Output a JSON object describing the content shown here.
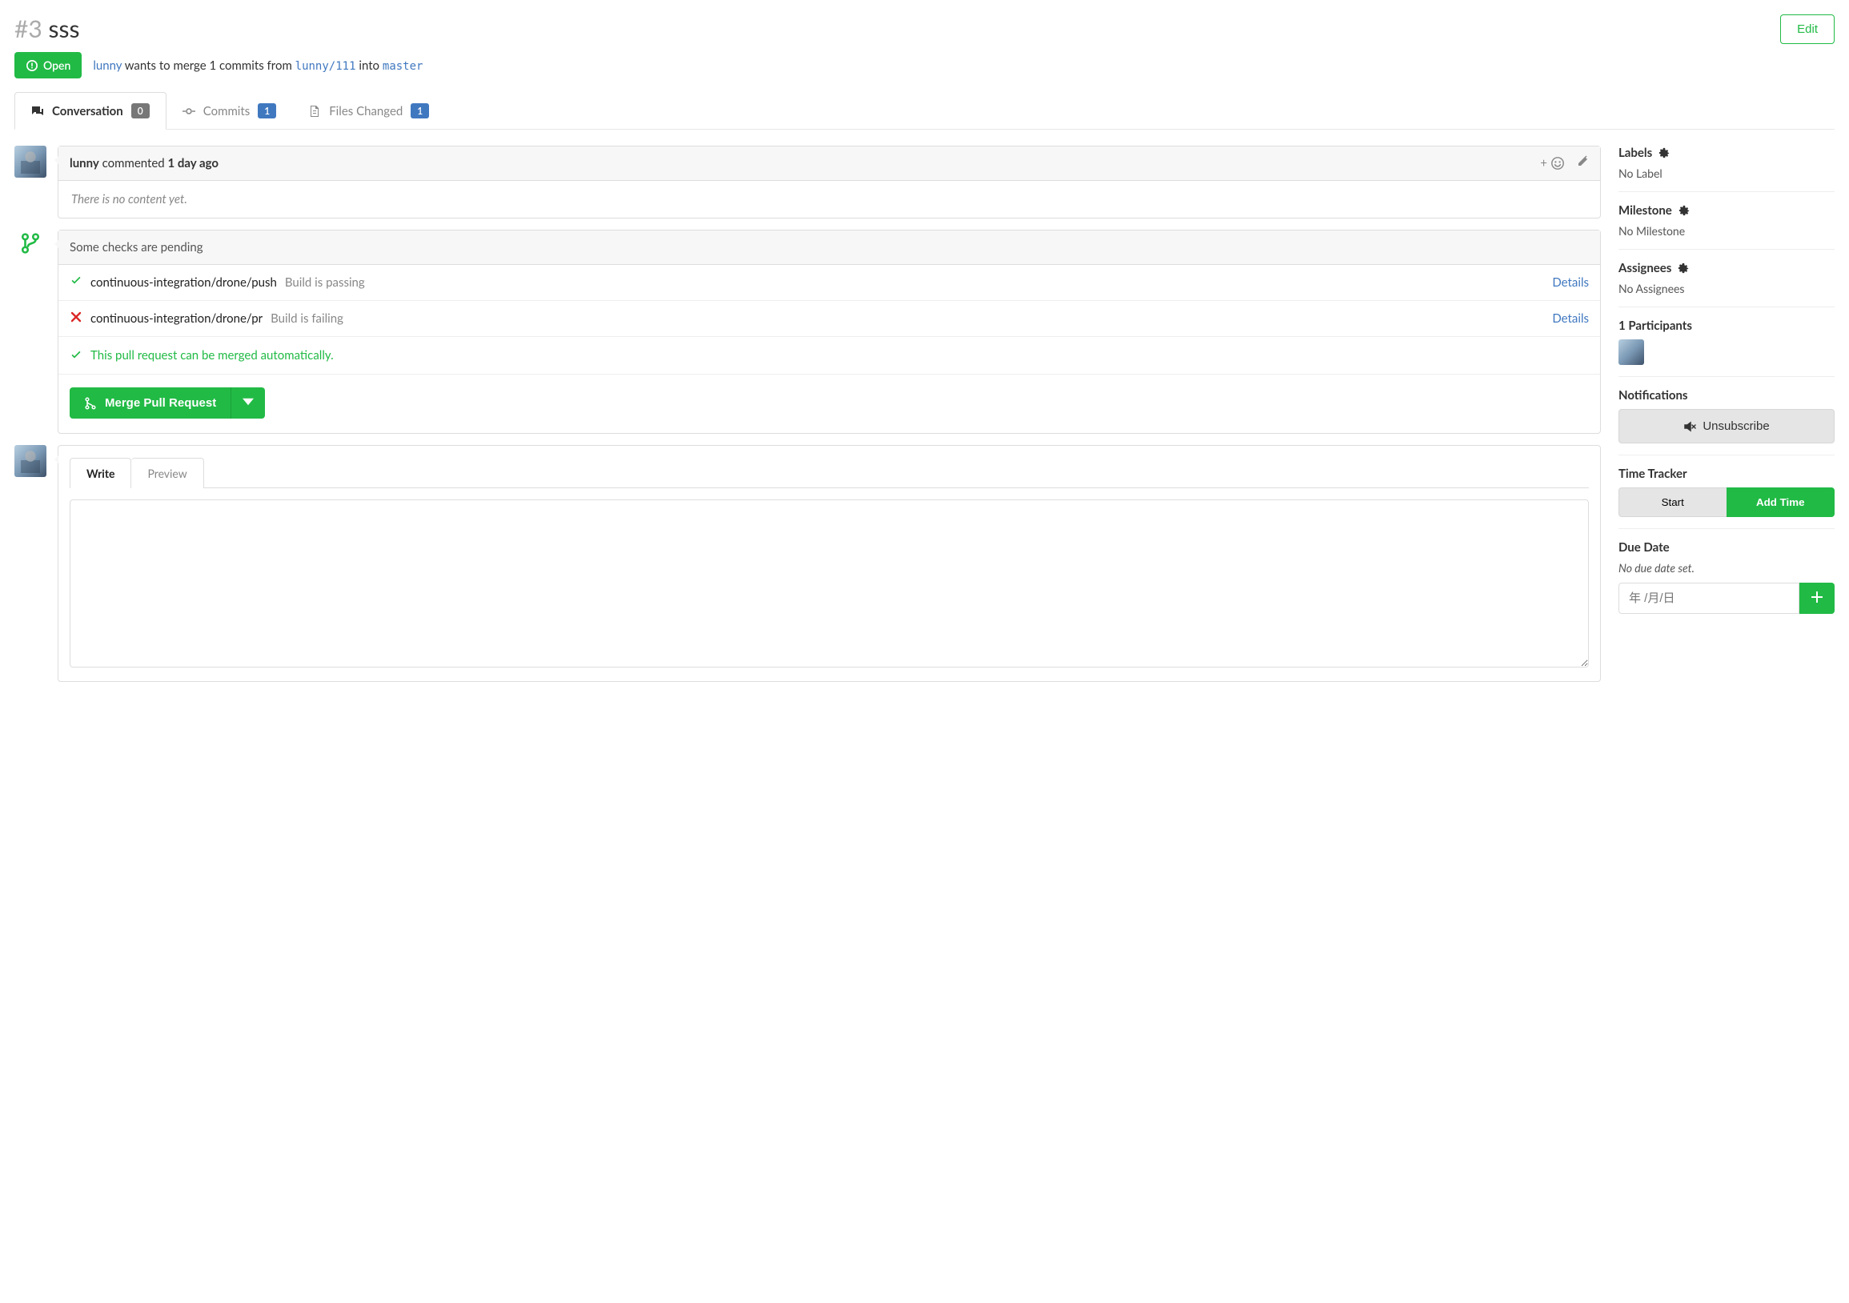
{
  "pr": {
    "number": "#3",
    "title": "sss",
    "state_label": "Open",
    "author": "lunny",
    "merge_intro": " wants to merge 1 commits from ",
    "from_branch": "lunny/111",
    "into_word": " into ",
    "to_branch": "master"
  },
  "header": {
    "edit_label": "Edit"
  },
  "tabs": {
    "conversation_label": "Conversation",
    "conversation_count": "0",
    "commits_label": "Commits",
    "commits_count": "1",
    "files_label": "Files Changed",
    "files_count": "1"
  },
  "comment": {
    "author": "lunny",
    "verb": " commented ",
    "when": "1 day ago",
    "body": "There is no content yet.",
    "react_plus": "+"
  },
  "checks": {
    "heading": "Some checks are pending",
    "rows": [
      {
        "status": "pass",
        "context": "continuous-integration/drone/push",
        "sub": "Build is passing",
        "details_label": "Details"
      },
      {
        "status": "fail",
        "context": "continuous-integration/drone/pr",
        "sub": "Build is failing",
        "details_label": "Details"
      }
    ],
    "merge_ok": "This pull request can be merged automatically.",
    "merge_button": "Merge Pull Request"
  },
  "editor": {
    "write_label": "Write",
    "preview_label": "Preview"
  },
  "sidebar": {
    "labels_head": "Labels",
    "labels_none": "No Label",
    "milestone_head": "Milestone",
    "milestone_none": "No Milestone",
    "assignees_head": "Assignees",
    "assignees_none": "No Assignees",
    "participants_head": "1 Participants",
    "notifications_head": "Notifications",
    "unsubscribe_label": "Unsubscribe",
    "timetracker_head": "Time Tracker",
    "timetracker_start": "Start",
    "timetracker_add": "Add Time",
    "duedate_head": "Due Date",
    "duedate_none": "No due date set.",
    "duedate_placeholder": "年 /月/日"
  }
}
